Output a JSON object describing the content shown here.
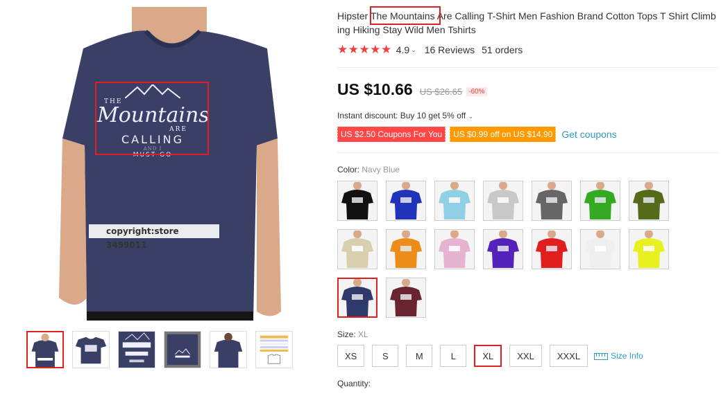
{
  "product": {
    "title_before": "Hipster ",
    "title_highlight": "The Mountains",
    "title_after": " Are Calling T-Shirt Men Fashion Brand Cotton Tops T Shirt Climbing Hiking Stay Wild Men Tshirts",
    "rating": "4.9",
    "reviews": "16 Reviews",
    "orders": "51 orders"
  },
  "main_image": {
    "print_lines": [
      "THE",
      "Mountains",
      "ARE",
      "CALLING",
      "AND I",
      "MUST GO"
    ],
    "copyright": "copyright:store 3499011",
    "shirt_color": "#3a3f66"
  },
  "thumbs": [
    "thumb-front",
    "thumb-flat",
    "thumb-print",
    "thumb-folded",
    "thumb-back",
    "thumb-size-chart"
  ],
  "price": {
    "current": "US $10.66",
    "original": "US $26.65",
    "discount": "-60%"
  },
  "instant_discount": "Instant discount: Buy 10 get 5% off",
  "coupons": {
    "c1": "US $2.50 Coupons For You",
    "c2": "US $0.99 off on US $14.90",
    "get": "Get coupons"
  },
  "color": {
    "label": "Color:",
    "selected": "Navy Blue",
    "options": [
      "#111111",
      "#2233bb",
      "#8fd0e6",
      "#c8c8c8",
      "#666666",
      "#33aa22",
      "#556b1a",
      "#d8cfae",
      "#ee8c1a",
      "#e6b3d0",
      "#5522bb",
      "#e01e1e",
      "#efefef",
      "#e8f020",
      "#303a6a",
      "#6a2430"
    ]
  },
  "size": {
    "label": "Size:",
    "selected": "XL",
    "options": [
      "XS",
      "S",
      "M",
      "L",
      "XL",
      "XXL",
      "XXXL"
    ],
    "info": "Size Info"
  },
  "quantity_label": "Quantity:",
  "colors": {
    "accent": "#e02020",
    "link": "#2e9cc3",
    "star": "#f0403c"
  }
}
